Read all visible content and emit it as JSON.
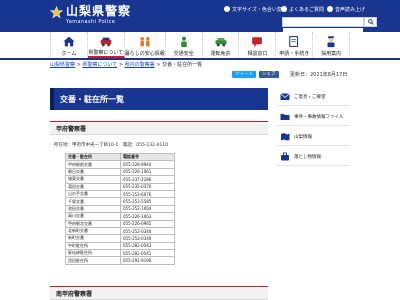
{
  "header": {
    "title": "山梨県警察",
    "subtitle": "Yamanashi Police",
    "utility_links": [
      "文字サイズ・色合い変更",
      "よくあるご質問",
      "音声読み上げ"
    ],
    "search_placeholder": ""
  },
  "nav": {
    "items": [
      {
        "label": "ホーム"
      },
      {
        "label": "県警察について"
      },
      {
        "label": "暮らしの安心情報"
      },
      {
        "label": "交通安全"
      },
      {
        "label": "運転免許"
      },
      {
        "label": "相談窓口"
      },
      {
        "label": "申請・手続き"
      },
      {
        "label": "採用案内"
      }
    ]
  },
  "breadcrumb": {
    "links": [
      "山梨県警察",
      "県警察について",
      "県内の警察署"
    ],
    "separator": ">",
    "current": "交番・駐在所一覧"
  },
  "share": {
    "tweet": "ツイート",
    "fb": "シェア"
  },
  "updated": "更新日：2021年8月17日",
  "main": {
    "title": "交番・駐在所一覧",
    "section1": {
      "heading": "甲府警察署",
      "address": "所在地：甲府市中央一丁目10-1　電話：055-232-0110"
    },
    "table": {
      "headers": [
        "交番・駐在所",
        "電話番号"
      ],
      "rows": [
        [
          "甲府駅前交番",
          "055-226-9944"
        ],
        [
          "朝日交番",
          "055-226-1061"
        ],
        [
          "城東交番",
          "055-237-2286"
        ],
        [
          "湯田交番",
          "055-235-0370"
        ],
        [
          "山の手交番",
          "055-253-6076"
        ],
        [
          "千塚交番",
          "055-253-5585"
        ],
        [
          "池田交番",
          "055-252-1064"
        ],
        [
          "貢川交番",
          "055-226-1063"
        ],
        [
          "甲府駅北交番",
          "055-226-0965"
        ],
        [
          "北新町交番",
          "055-252-0340"
        ],
        [
          "新町交番",
          "055-253-0349"
        ],
        [
          "中町駐在所",
          "055-282-0543"
        ],
        [
          "昇仙峡駐在所",
          "055-282-0541"
        ],
        [
          "西田駐在所",
          "055-291-9190"
        ]
      ]
    },
    "section2": {
      "heading": "南甲府警察署"
    }
  },
  "sidebar": {
    "items": [
      {
        "label": "ご意見・ご要望"
      },
      {
        "label": "事件・事故情報ファイル"
      },
      {
        "label": "山梨情報"
      },
      {
        "label": "落とし物情報"
      }
    ]
  },
  "colors": {
    "brand": "#183590",
    "accent": "#c5212c"
  }
}
